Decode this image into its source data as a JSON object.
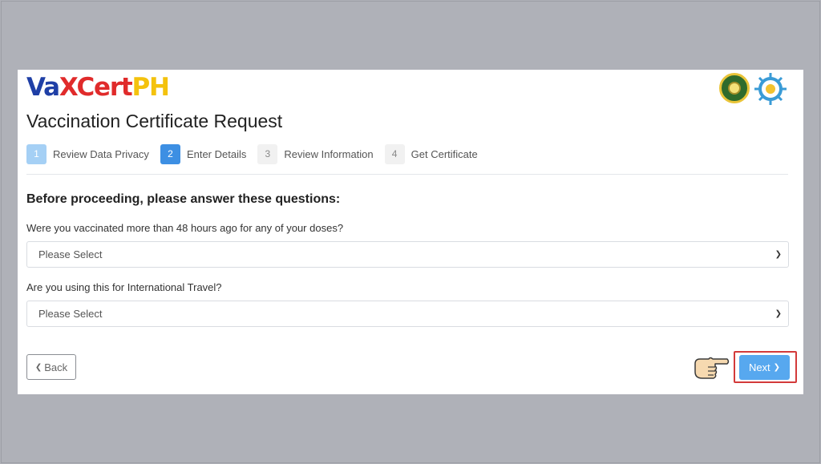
{
  "brand": {
    "logo_va": "Va",
    "logo_x": "X",
    "logo_cert": "Cert",
    "logo_ph": "PH"
  },
  "page_title": "Vaccination Certificate Request",
  "stepper": {
    "steps": [
      {
        "number": "1",
        "label": "Review Data Privacy",
        "state": "done"
      },
      {
        "number": "2",
        "label": "Enter Details",
        "state": "active"
      },
      {
        "number": "3",
        "label": "Review Information",
        "state": "todo"
      },
      {
        "number": "4",
        "label": "Get Certificate",
        "state": "todo"
      }
    ]
  },
  "questions": {
    "heading": "Before proceeding, please answer these questions:",
    "items": [
      {
        "label": "Were you vaccinated more than 48 hours ago for any of your doses?",
        "selected": "Please Select"
      },
      {
        "label": "Are you using this for International Travel?",
        "selected": "Please Select"
      }
    ]
  },
  "actions": {
    "back_label": "Back",
    "next_label": "Next"
  },
  "colors": {
    "primary": "#3d8fe3",
    "next_button": "#57a8ef",
    "highlight": "#d33a3a",
    "logo_blue": "#1f3fa6",
    "logo_red": "#e02b2b",
    "logo_yellow": "#f4c20d"
  },
  "icons": {
    "back": "chevron-left-icon",
    "next": "chevron-right-icon",
    "select": "chevron-down-icon",
    "pointer": "pointing-hand-icon"
  }
}
